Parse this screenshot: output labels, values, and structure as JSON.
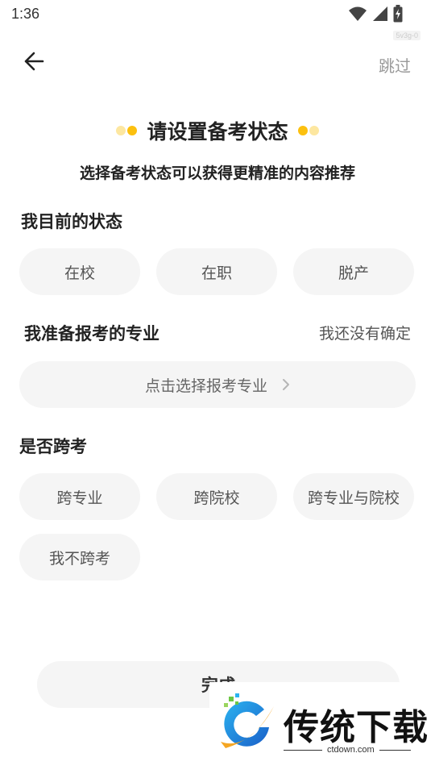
{
  "status_bar": {
    "time": "1:36",
    "icons": [
      "wifi-icon",
      "signal-icon",
      "battery-charging-icon"
    ],
    "debug_tag": "5v3g-0"
  },
  "nav": {
    "back_icon": "arrow-left-icon",
    "skip_label": "跳过"
  },
  "header": {
    "title": "请设置备考状态",
    "subtitle": "选择备考状态可以获得更精准的内容推荐",
    "accent_color": "#FCC00F"
  },
  "status_section": {
    "title": "我目前的状态",
    "options": [
      "在校",
      "在职",
      "脱产"
    ]
  },
  "major_section": {
    "title": "我准备报考的专业",
    "undecided_label": "我还没有确定",
    "select_label": "点击选择报考专业"
  },
  "cross_section": {
    "title": "是否跨考",
    "options": [
      "跨专业",
      "跨院校",
      "跨专业与院校",
      "我不跨考"
    ]
  },
  "finish": {
    "label": "完成"
  },
  "watermark": {
    "title": "传统下载",
    "url": "ctdown.com"
  }
}
